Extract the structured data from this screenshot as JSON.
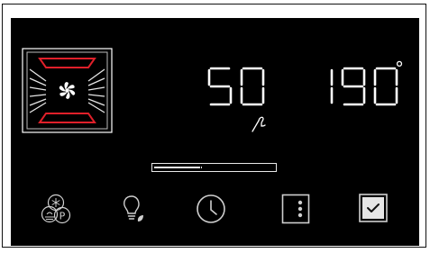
{
  "display": {
    "cooking_time": "50",
    "temperature": "190",
    "temperature_unit": "°"
  },
  "progress": {
    "fraction": 0.4,
    "marker_fraction": 0.38
  },
  "oven_mode": {
    "icon": "fan-with-top-and-bottom-heat-icon"
  },
  "controls": [
    {
      "name": "special-functions-button",
      "icon": "defrost-pizza-proof-icon"
    },
    {
      "name": "oven-light-button",
      "icon": "light-bulb-eco-icon"
    },
    {
      "name": "timer-button",
      "icon": "clock-icon"
    },
    {
      "name": "shelf-position-button",
      "icon": "rack-levels-icon"
    },
    {
      "name": "confirm-button",
      "icon": "checkbox-icon"
    }
  ],
  "colors": {
    "background": "#000000",
    "segments": "#ffffff",
    "heating_element": "#e0202a",
    "icons": "#cfcfcf"
  }
}
